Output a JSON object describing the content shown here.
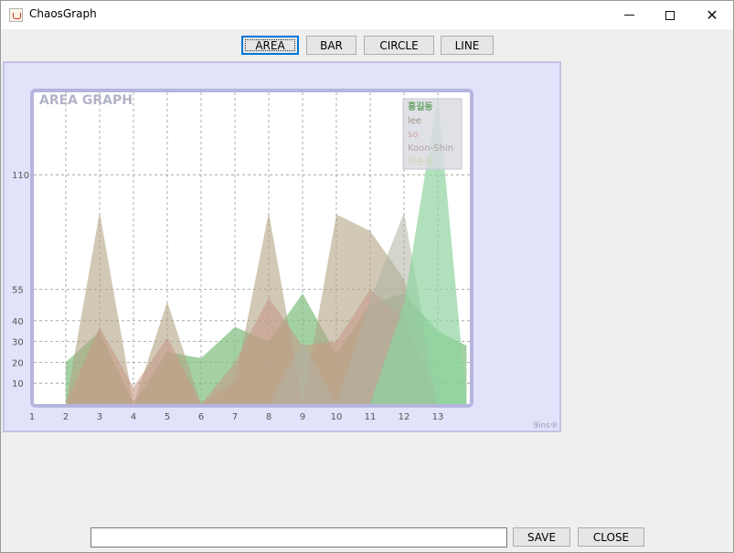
{
  "window": {
    "title": "ChaosGraph",
    "icon": "java-cup-icon"
  },
  "toolbar": {
    "buttons": [
      "AREA",
      "BAR",
      "CIRCLE",
      "LINE"
    ],
    "selected": "AREA"
  },
  "bottom": {
    "input_value": "",
    "save_label": "SAVE",
    "close_label": "CLOSE"
  },
  "chart_data": {
    "type": "area",
    "title": "AREA GRAPH",
    "watermark": "9ins®",
    "x": [
      1,
      2,
      3,
      4,
      5,
      6,
      7,
      8,
      9,
      10,
      11,
      12,
      13
    ],
    "x_ticks": [
      "1",
      "2",
      "3",
      "4",
      "5",
      "6",
      "7",
      "8",
      "9",
      "10",
      "11",
      "12",
      "13"
    ],
    "y_ticks": [
      10,
      20,
      30,
      40,
      55,
      110
    ],
    "ylim": [
      0,
      148
    ],
    "grid": true,
    "legend_position": "top-right",
    "series": [
      {
        "name": "홍길동",
        "color": "#7fbf7f",
        "legend_color": "#6aa66a",
        "opacity": 0.72,
        "values": [
          null,
          20,
          35,
          0,
          25,
          22,
          37,
          30,
          53,
          24,
          48,
          53,
          35,
          28
        ]
      },
      {
        "name": "lee",
        "color": "#b3a484",
        "legend_color": "#9f9584",
        "opacity": 0.6,
        "values": [
          null,
          0,
          92,
          0,
          49,
          0,
          10,
          92,
          0,
          91,
          83,
          60,
          0,
          0
        ]
      },
      {
        "name": "so",
        "color": "#c79988",
        "legend_color": "#cfa4a4",
        "opacity": 0.6,
        "values": [
          null,
          0,
          37,
          8,
          32,
          0,
          20,
          51,
          28,
          30,
          55,
          41,
          0,
          0
        ]
      },
      {
        "name": "Koon-Shin",
        "color": "#b0b2a4",
        "legend_color": "#b2a3a3",
        "opacity": 0.55,
        "values": [
          null,
          0,
          0,
          0,
          0,
          0,
          0,
          0,
          30,
          0,
          50,
          92,
          0,
          0
        ]
      },
      {
        "name": "이순신",
        "color": "#8fd49f",
        "legend_color": "#c9d6a3",
        "opacity": 0.7,
        "values": [
          null,
          0,
          0,
          0,
          0,
          0,
          0,
          0,
          0,
          0,
          0,
          48,
          148,
          0
        ]
      }
    ]
  }
}
